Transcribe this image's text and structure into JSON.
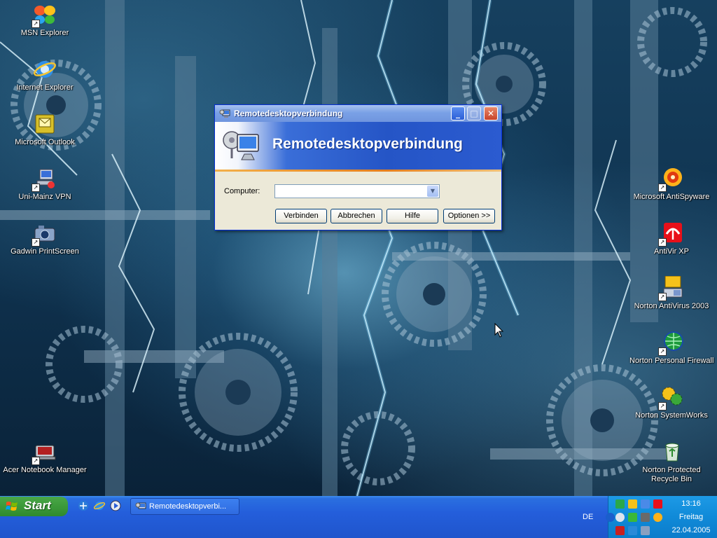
{
  "desktop": {
    "left_icons": [
      {
        "label": "MSN Explorer",
        "icon": "msn-butterfly-icon"
      },
      {
        "label": "Internet Explorer",
        "icon": "internet-explorer-icon"
      },
      {
        "label": "Microsoft Outlook",
        "icon": "outlook-icon"
      },
      {
        "label": "Uni-Mainz VPN",
        "icon": "vpn-icon"
      },
      {
        "label": "Gadwin PrintScreen",
        "icon": "printscreen-camera-icon"
      },
      {
        "label": "Acer Notebook Manager",
        "icon": "notebook-manager-icon"
      }
    ],
    "right_icons": [
      {
        "label": "Microsoft AntiSpyware",
        "icon": "antispyware-icon"
      },
      {
        "label": "AntiVir XP",
        "icon": "antivir-umbrella-icon"
      },
      {
        "label": "Norton AntiVirus 2003",
        "icon": "norton-antivirus-icon"
      },
      {
        "label": "Norton Personal Firewall",
        "icon": "norton-firewall-globe-icon"
      },
      {
        "label": "Norton SystemWorks",
        "icon": "norton-systemworks-icon"
      },
      {
        "label": "Norton Protected Recycle Bin",
        "icon": "recycle-bin-icon"
      }
    ]
  },
  "dialog": {
    "title": "Remotedesktopverbindung",
    "banner_title": "Remotedesktopverbindung",
    "computer_label": "Computer:",
    "computer_value": "",
    "buttons": {
      "connect": "Verbinden",
      "cancel": "Abbrechen",
      "help": "Hilfe",
      "options": "Optionen >>"
    },
    "titlebar_buttons": {
      "minimize": "_",
      "maximize": "□",
      "close": "✕"
    }
  },
  "taskbar": {
    "start_label": "Start",
    "task_button_label": "Remotedesktopverbi...",
    "language": "DE",
    "clock_time": "13:16",
    "clock_day": "Freitag",
    "clock_date": "22.04.2005"
  },
  "colors": {
    "dialog_titlebar": "#7aa1e6",
    "banner_blue": "#2555c6",
    "taskbar_blue": "#245edb",
    "start_green": "#3c9a3a",
    "tray_blue": "#108ad8"
  }
}
